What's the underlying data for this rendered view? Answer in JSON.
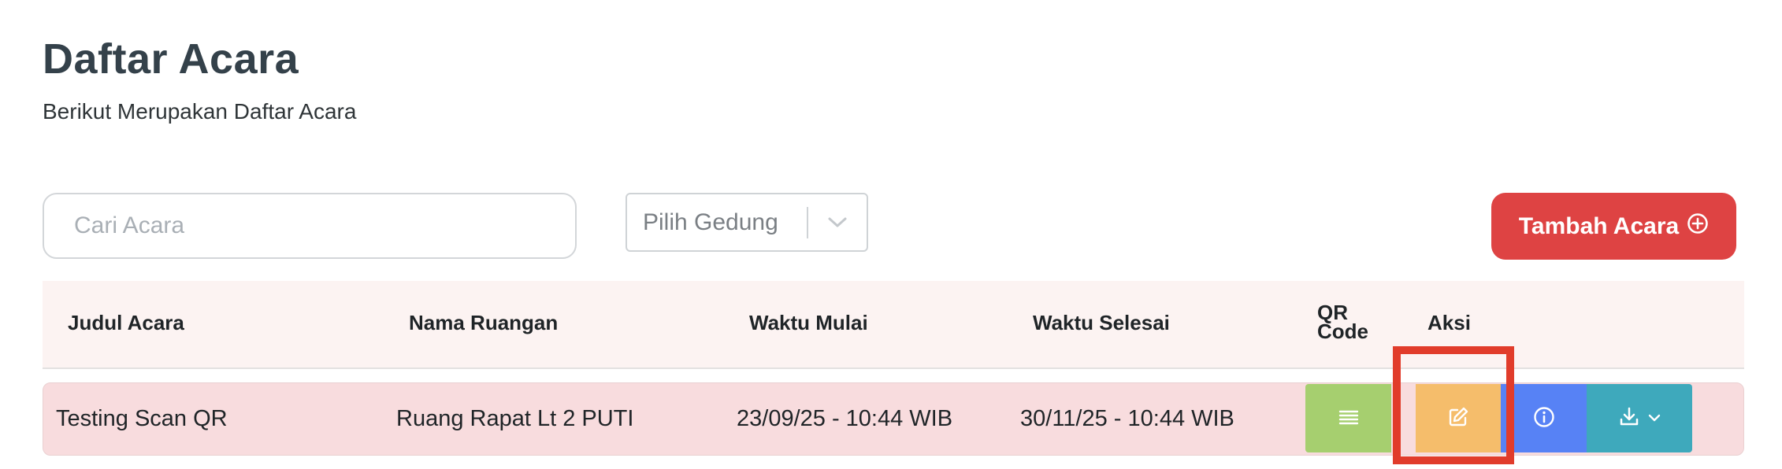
{
  "header": {
    "title": "Daftar Acara",
    "subtitle": "Berikut Merupakan Daftar Acara"
  },
  "toolbar": {
    "search_placeholder": "Cari Acara",
    "building_select_label": "Pilih Gedung",
    "add_button_label": "Tambah Acara"
  },
  "table": {
    "columns": {
      "title": "Judul Acara",
      "room": "Nama Ruangan",
      "start": "Waktu Mulai",
      "end": "Waktu Selesai",
      "qr_line1": "QR",
      "qr_line2": "Code",
      "actions": "Aksi"
    },
    "rows": [
      {
        "title": "Testing Scan QR",
        "room": "Ruang Rapat Lt 2 PUTI",
        "start": "23/09/25 - 10:44 WIB",
        "end": "30/11/25 - 10:44 WIB"
      }
    ]
  },
  "icons": {
    "qr_button": "list-icon",
    "edit_button": "edit-icon",
    "info_button": "info-icon",
    "download_button": "download-icon",
    "add_button": "plus-circle-icon",
    "select": "chevron-down-icon"
  },
  "colors": {
    "title": "#34414a",
    "add_button": "#de4343",
    "header_bg": "#fcf3f2",
    "row_bg": "#f8dcde",
    "qr_button": "#a6cf6f",
    "edit_button": "#f5bd6b",
    "info_button": "#5782f5",
    "download_button": "#3ea9bc",
    "highlight": "#e13c2b"
  }
}
